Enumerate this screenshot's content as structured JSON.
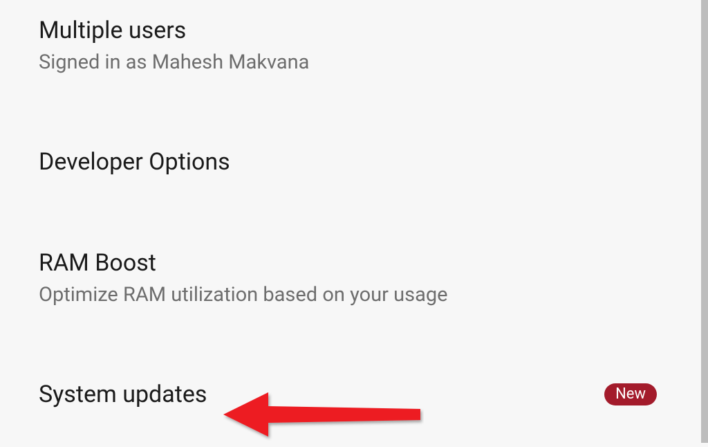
{
  "settings": {
    "multipleUsers": {
      "title": "Multiple users",
      "subtitle": "Signed in as Mahesh Makvana"
    },
    "developerOptions": {
      "title": "Developer Options"
    },
    "ramBoost": {
      "title": "RAM Boost",
      "subtitle": "Optimize RAM utilization based on your usage"
    },
    "systemUpdates": {
      "title": "System updates",
      "badge": "New"
    }
  }
}
